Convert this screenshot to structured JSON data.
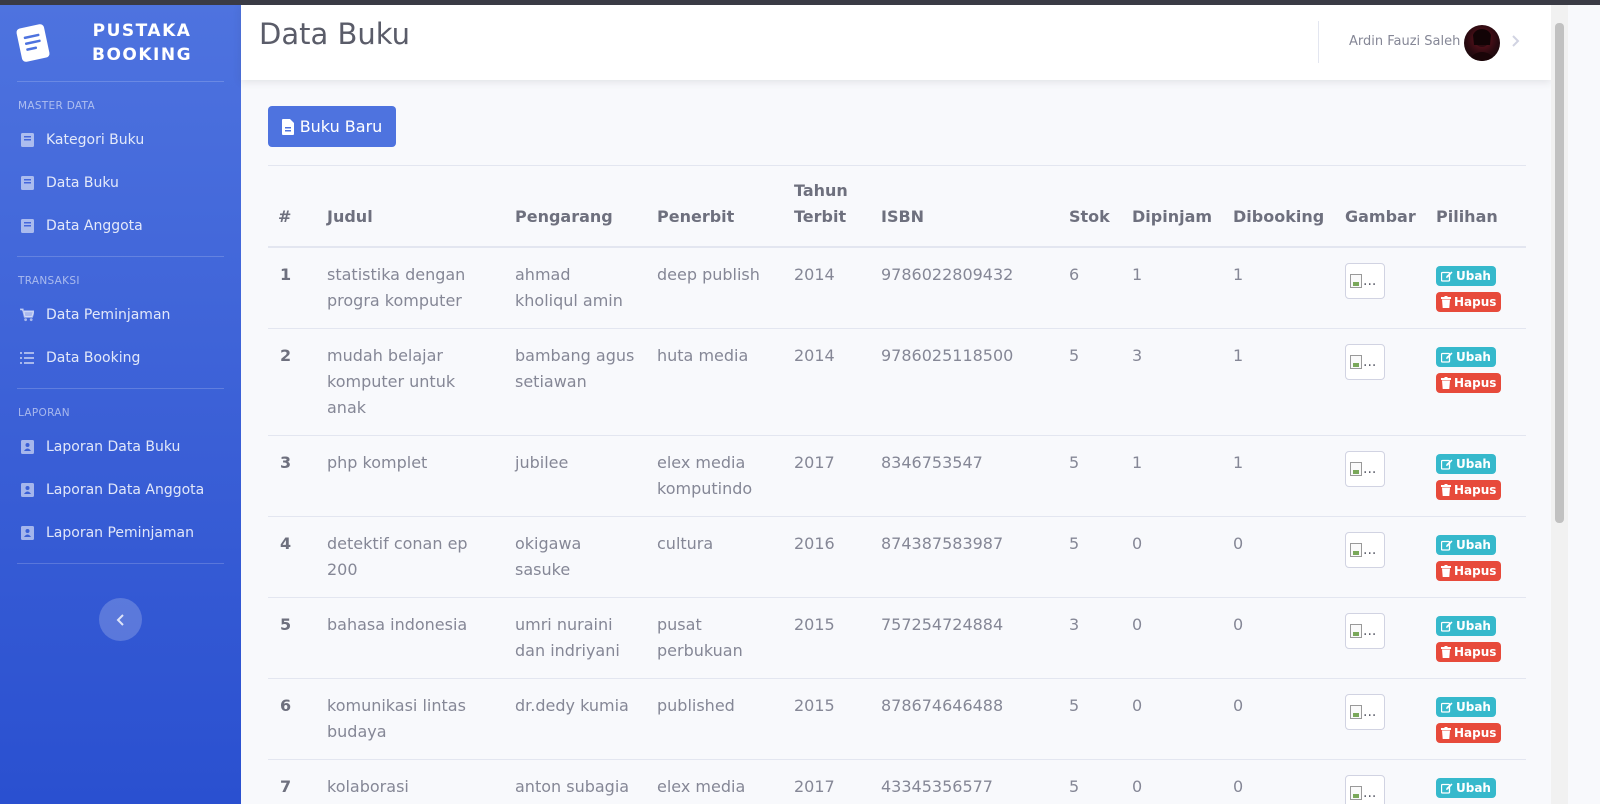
{
  "brand": {
    "line1": "PUSTAKA",
    "line2": "BOOKING"
  },
  "sidebar": {
    "sections": [
      {
        "heading": "MASTER DATA",
        "items": [
          {
            "label": "Kategori Buku",
            "icon": "book-icon"
          },
          {
            "label": "Data Buku",
            "icon": "book-icon"
          },
          {
            "label": "Data Anggota",
            "icon": "book-icon"
          }
        ]
      },
      {
        "heading": "TRANSAKSI",
        "items": [
          {
            "label": "Data Peminjaman",
            "icon": "cart-icon"
          },
          {
            "label": "Data Booking",
            "icon": "list-icon"
          }
        ]
      },
      {
        "heading": "LAPORAN",
        "items": [
          {
            "label": "Laporan Data Buku",
            "icon": "address-book-icon"
          },
          {
            "label": "Laporan Data Anggota",
            "icon": "address-book-icon"
          },
          {
            "label": "Laporan Peminjaman",
            "icon": "address-book-icon"
          }
        ]
      }
    ]
  },
  "header": {
    "title": "Data Buku",
    "user_name": "Ardin Fauzi Saleh"
  },
  "toolbar": {
    "new_button_label": "Buku Baru"
  },
  "table": {
    "columns": [
      "#",
      "Judul",
      "Pengarang",
      "Penerbit",
      "Tahun Terbit",
      "ISBN",
      "Stok",
      "Dipinjam",
      "Dibooking",
      "Gambar",
      "Pilihan"
    ],
    "rows": [
      {
        "no": "1",
        "judul": "statistika dengan progra komputer",
        "pengarang": "ahmad kholiqul amin",
        "penerbit": "deep publish",
        "tahun": "2014",
        "isbn": "9786022809432",
        "stok": "6",
        "dipinjam": "1",
        "dibooking": "1"
      },
      {
        "no": "2",
        "judul": "mudah belajar komputer untuk anak",
        "pengarang": "bambang agus setiawan",
        "penerbit": "huta media",
        "tahun": "2014",
        "isbn": "9786025118500",
        "stok": "5",
        "dipinjam": "3",
        "dibooking": "1"
      },
      {
        "no": "3",
        "judul": "php komplet",
        "pengarang": "jubilee",
        "penerbit": "elex media komputindo",
        "tahun": "2017",
        "isbn": "8346753547",
        "stok": "5",
        "dipinjam": "1",
        "dibooking": "1"
      },
      {
        "no": "4",
        "judul": "detektif conan ep 200",
        "pengarang": "okigawa sasuke",
        "penerbit": "cultura",
        "tahun": "2016",
        "isbn": "874387583987",
        "stok": "5",
        "dipinjam": "0",
        "dibooking": "0"
      },
      {
        "no": "5",
        "judul": "bahasa indonesia",
        "pengarang": "umri nuraini dan indriyani",
        "penerbit": "pusat perbukuan",
        "tahun": "2015",
        "isbn": "757254724884",
        "stok": "3",
        "dipinjam": "0",
        "dibooking": "0"
      },
      {
        "no": "6",
        "judul": "komunikasi lintas budaya",
        "pengarang": "dr.dedy kumia",
        "penerbit": "published",
        "tahun": "2015",
        "isbn": "878674646488",
        "stok": "5",
        "dipinjam": "0",
        "dibooking": "0"
      },
      {
        "no": "7",
        "judul": "kolaborasi",
        "pengarang": "anton subagia",
        "penerbit": "elex media",
        "tahun": "2017",
        "isbn": "43345356577",
        "stok": "5",
        "dipinjam": "0",
        "dibooking": "0"
      }
    ],
    "image_alt": "...",
    "edit_label": "Ubah",
    "delete_label": "Hapus"
  },
  "colors": {
    "primary": "#4e73df",
    "info": "#36b9cc",
    "danger": "#e74a3b"
  }
}
